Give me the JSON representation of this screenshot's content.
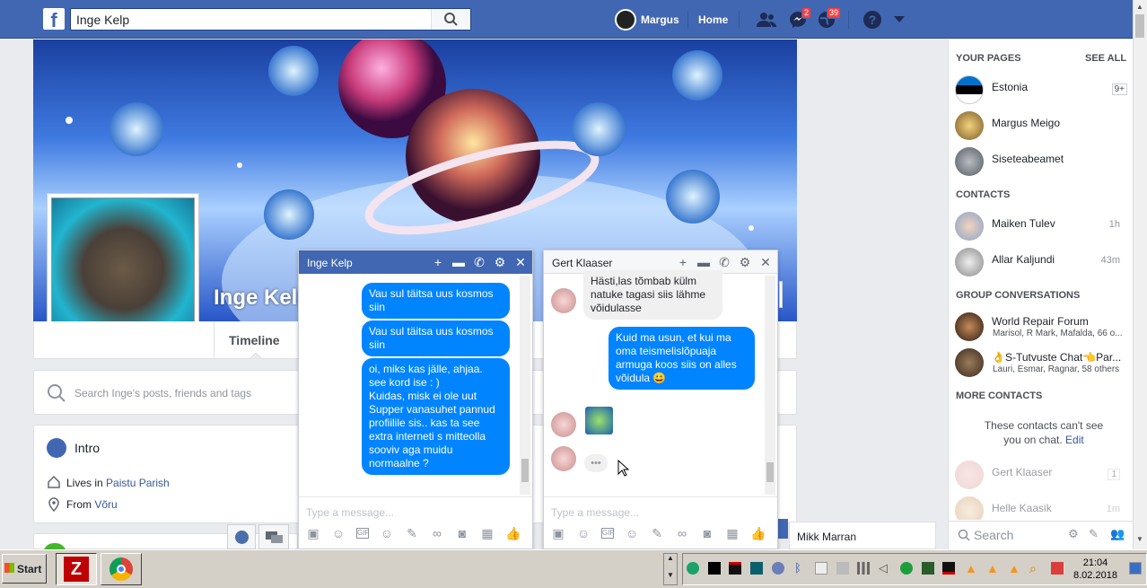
{
  "topbar": {
    "search_value": "Inge Kelp",
    "user_name": "Margus",
    "home_label": "Home",
    "messages_badge": "2",
    "notifications_badge": "39"
  },
  "profile": {
    "name": "Inge Kelp",
    "tab_timeline": "Timeline",
    "search_placeholder": "Search Inge's posts, friends and tags",
    "intro_title": "Intro",
    "lives_prefix": "Lives in",
    "lives_place": "Paistu Parish",
    "from_prefix": "From",
    "from_place": "Võru"
  },
  "sidebar": {
    "your_pages": "YOUR PAGES",
    "see_all": "SEE ALL",
    "pages": [
      {
        "name": "Estonia",
        "badge": "9+"
      },
      {
        "name": "Margus Meigo"
      },
      {
        "name": "Siseteabeamet"
      }
    ],
    "contacts_head": "CONTACTS",
    "contacts": [
      {
        "name": "Maiken Tulev",
        "time": "1h"
      },
      {
        "name": "Allar Kaljundi",
        "time": "43m"
      }
    ],
    "group_head": "GROUP CONVERSATIONS",
    "groups": [
      {
        "name": "World Repair Forum",
        "members": "Marisol, R Mark, Mafalda, 66 o..."
      },
      {
        "name": "👌S-Tutvuste Chat👈Par...",
        "members": "Lauri, Esmar, Ragnar, 58 others"
      }
    ],
    "more_head": "MORE CONTACTS",
    "more_text": "These contacts can't see you on chat.",
    "edit_link": "Edit",
    "offline": [
      {
        "name": "Gert Klaaser",
        "badge": "1"
      },
      {
        "name": "Helle Kaasik",
        "time": "1m"
      }
    ],
    "search_placeholder": "Search"
  },
  "chat1": {
    "title": "Inge Kelp",
    "messages": [
      "Vau sul täitsa uus kosmos siin",
      "Vau sul täitsa uus kosmos siin",
      "oi, miks kas jälle, ahjaa. see kord ise : )\nKuidas, misk ei ole uut Supper vanasuhet pannud profiilile sis.. kas ta see extra interneti s mitteolla sooviv aga muidu normaalne ?"
    ],
    "input_placeholder": "Type a message..."
  },
  "chat2": {
    "title": "Gert Klaaser",
    "incoming_top": "Hästi,las tõmbab külm natuke tagasi siis lähme võidulasse",
    "outgoing": "Kuid ma usun, et kui ma oma teismelislõpuaja armuga koos siis on alles võidula 😀",
    "typing": "•••",
    "input_placeholder": "Type a message..."
  },
  "bottom_bar": {
    "mikk": "Mikk Marran"
  },
  "taskbar": {
    "start": "Start",
    "time": "21:04",
    "date": "8.02.2018"
  }
}
